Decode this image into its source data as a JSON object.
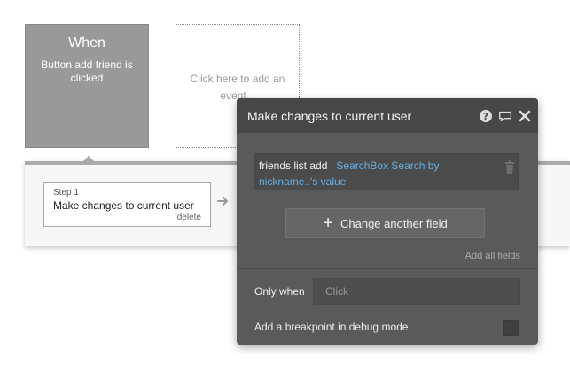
{
  "event": {
    "title": "When",
    "description": "Button add friend is clicked",
    "add_placeholder": "Click here to add an event..."
  },
  "step": {
    "number_label": "Step 1",
    "title": "Make changes to current user",
    "delete_label": "delete"
  },
  "panel": {
    "title": "Make changes to current user",
    "icons": [
      "help-icon",
      "comment-icon",
      "close-icon",
      "trash-icon",
      "arrow-right-icon",
      "plus-icon"
    ],
    "field": {
      "name": "friends list add",
      "value": "SearchBox Search by nickname..'s value"
    },
    "change_button_label": "Change another field",
    "add_all_label": "Add all fields",
    "only_when_label": "Only when",
    "only_when_placeholder": "Click",
    "breakpoint_label": "Add a breakpoint in debug mode"
  },
  "colors": {
    "event_card": "#999999",
    "panel_bg": "#5a5a5a",
    "panel_header": "#474747",
    "link_blue": "#66aee3"
  }
}
